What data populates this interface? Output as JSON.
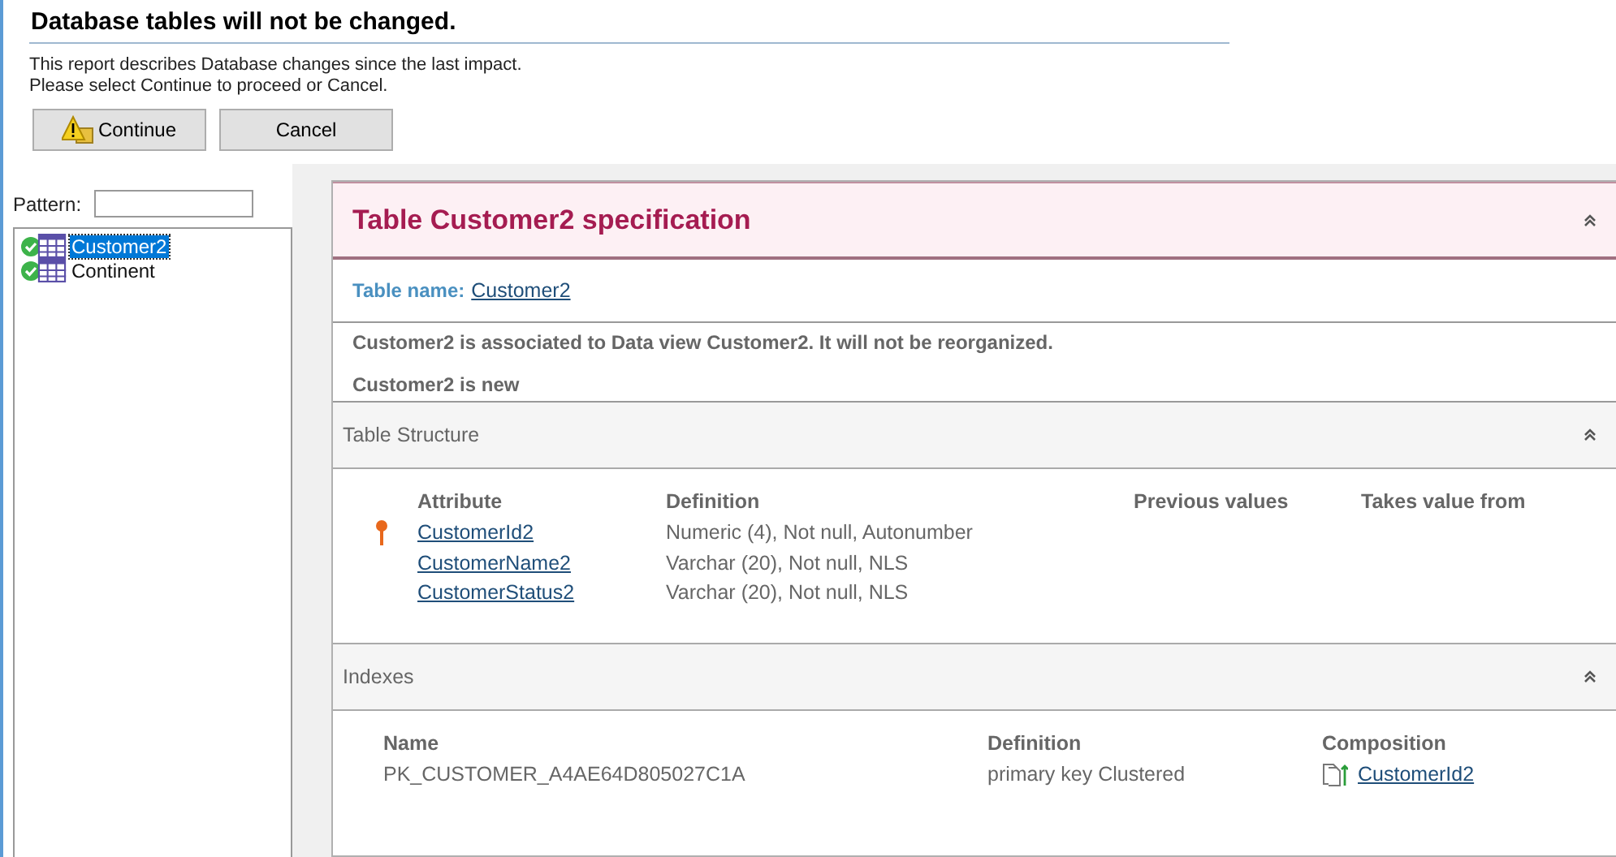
{
  "title": "Database tables will not be changed.",
  "description": [
    "This report describes Database changes since the last impact.",
    "Please select Continue to proceed or Cancel."
  ],
  "buttons": [
    {
      "label": "Continue",
      "kind": "warning"
    },
    {
      "label": "Cancel",
      "kind": "plain"
    }
  ],
  "pattern": {
    "label": "Pattern:"
  },
  "tables": [
    {
      "name": "Customer2",
      "selected": true,
      "ok": true
    },
    {
      "name": "Continent",
      "selected": false,
      "ok": true
    }
  ],
  "spec": {
    "title": "Table Customer2 specification",
    "table_name_label": "Table name:",
    "table_name": "Customer2",
    "messages": [
      "Customer2 is associated to Data view Customer2. It will not be reorganized.",
      "Customer2 is new"
    ]
  },
  "structure": {
    "title": "Table Structure",
    "columns": [
      "Attribute",
      "Definition",
      "Previous values",
      "Takes value from"
    ],
    "rows": [
      {
        "attribute": "CustomerId2",
        "definition": "Numeric (4), Not null, Autonumber",
        "key": true
      },
      {
        "attribute": "CustomerName2",
        "definition": "Varchar (20), Not null, NLS",
        "key": false
      },
      {
        "attribute": "CustomerStatus2",
        "definition": "Varchar (20), Not null, NLS",
        "key": false
      }
    ]
  },
  "indexes": {
    "title": "Indexes",
    "columns": [
      "Name",
      "Definition",
      "Composition"
    ],
    "rows": [
      {
        "name": "PK_CUSTOMER_A4AE64D805027C1A",
        "definition": "primary key Clustered",
        "composition": "CustomerId2"
      }
    ]
  }
}
